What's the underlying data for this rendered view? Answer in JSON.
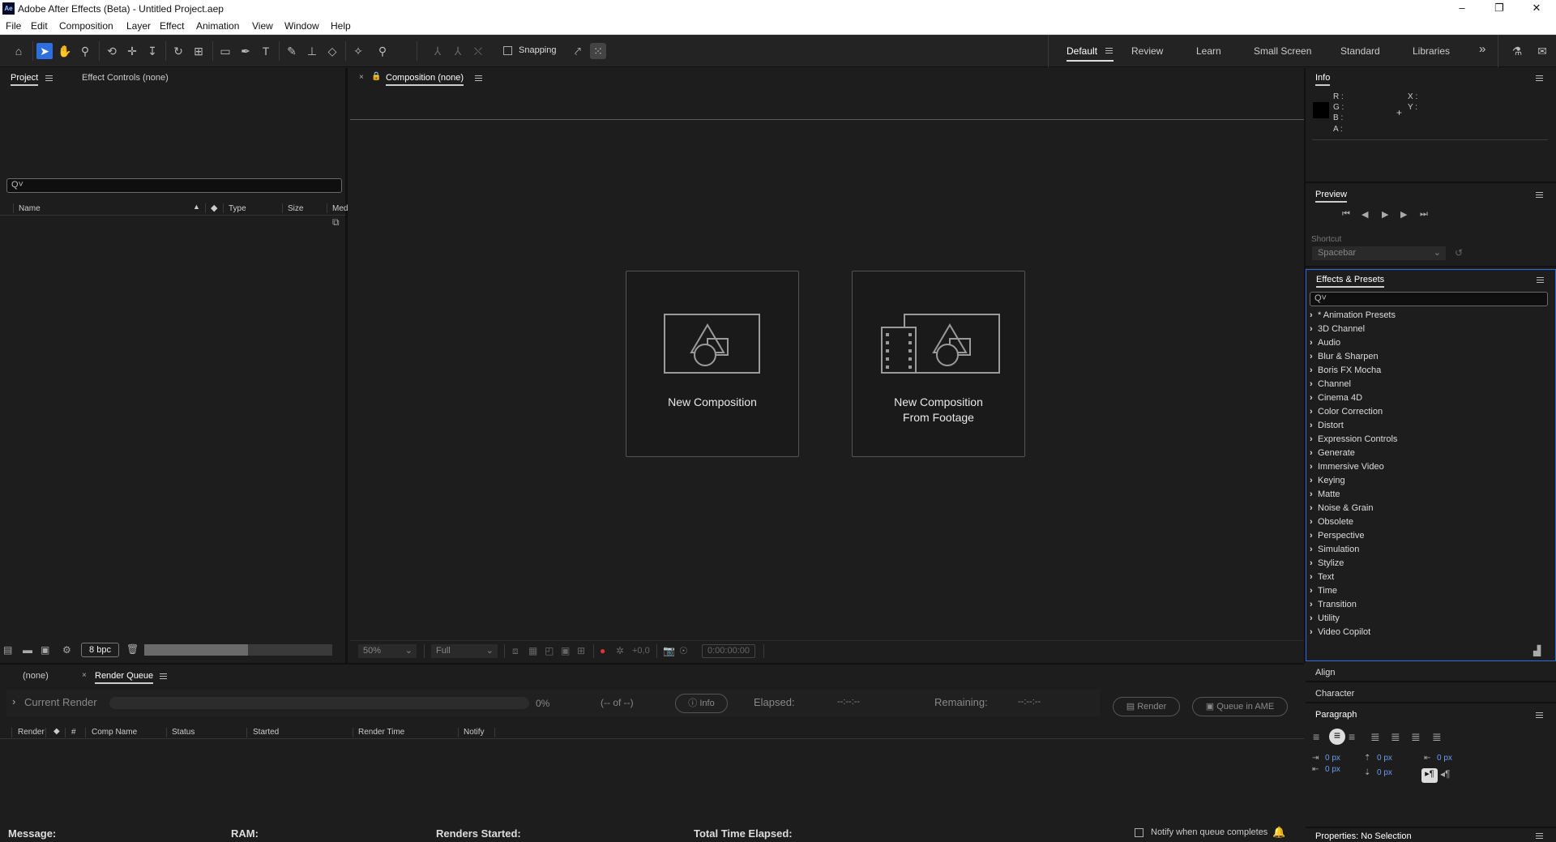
{
  "titlebar": {
    "app_icon": "Ae",
    "title": "Adobe After Effects (Beta) - Untitled Project.aep"
  },
  "menu": [
    "File",
    "Edit",
    "Composition",
    "Layer",
    "Effect",
    "Animation",
    "View",
    "Window",
    "Help"
  ],
  "toolbar": {
    "snapping_label": "Snapping",
    "snapping_checked": false
  },
  "workspaces": {
    "items": [
      "Default",
      "Review",
      "Learn",
      "Small Screen",
      "Standard",
      "Libraries"
    ],
    "active": "Default",
    "overflow": "»"
  },
  "project_panel": {
    "tabs": [
      "Project",
      "Effect Controls (none)"
    ],
    "search": "Q˅",
    "columns": [
      "Name",
      "Type",
      "Size",
      "Med"
    ],
    "bpc": "8 bpc"
  },
  "composition_panel": {
    "tab": "Composition (none)",
    "cards": [
      {
        "label_line1": "New Composition",
        "label_line2": ""
      },
      {
        "label_line1": "New Composition",
        "label_line2": "From Footage"
      }
    ],
    "zoom": "50%",
    "resolution": "Full",
    "exposure": "+0,0",
    "timecode": "0:00:00:00"
  },
  "info_panel": {
    "title": "Info",
    "labels": [
      "R :",
      "G :",
      "B :",
      "A :"
    ],
    "xy": [
      "X :",
      "Y :"
    ],
    "color": "#000000"
  },
  "preview_panel": {
    "title": "Preview",
    "shortcut_label": "Shortcut",
    "shortcut_value": "Spacebar"
  },
  "effects_presets": {
    "title": "Effects & Presets",
    "search": "Q˅",
    "items": [
      "* Animation Presets",
      "3D Channel",
      "Audio",
      "Blur & Sharpen",
      "Boris FX Mocha",
      "Channel",
      "Cinema 4D",
      "Color Correction",
      "Distort",
      "Expression Controls",
      "Generate",
      "Immersive Video",
      "Keying",
      "Matte",
      "Noise & Grain",
      "Obsolete",
      "Perspective",
      "Simulation",
      "Stylize",
      "Text",
      "Time",
      "Transition",
      "Utility",
      "Video Copilot"
    ]
  },
  "side_panels": {
    "align": "Align",
    "character": "Character",
    "paragraph": "Paragraph",
    "properties": "Properties: No Selection"
  },
  "paragraph": {
    "values": [
      "0 px",
      "0 px",
      "0 px",
      "0 px",
      "0 px"
    ]
  },
  "bottom_tabs": [
    "(none)",
    "Render Queue"
  ],
  "render_queue": {
    "current_render": "Current Render",
    "progress": 0,
    "percent": "0%",
    "count": "(-- of --)",
    "info": "Info",
    "elapsed_label": "Elapsed:",
    "elapsed_value": "--:--:--",
    "remaining_label": "Remaining:",
    "remaining_value": "--:--:--",
    "render_button": "Render",
    "queue_ame_button": "Queue in AME",
    "columns": [
      "Render",
      "#",
      "Comp Name",
      "Status",
      "Started",
      "Render Time",
      "Notify"
    ]
  },
  "status_bar": {
    "message": "Message:",
    "ram": "RAM:",
    "renders_started": "Renders Started:",
    "total_time": "Total Time Elapsed:",
    "notify_label": "Notify when queue completes"
  }
}
